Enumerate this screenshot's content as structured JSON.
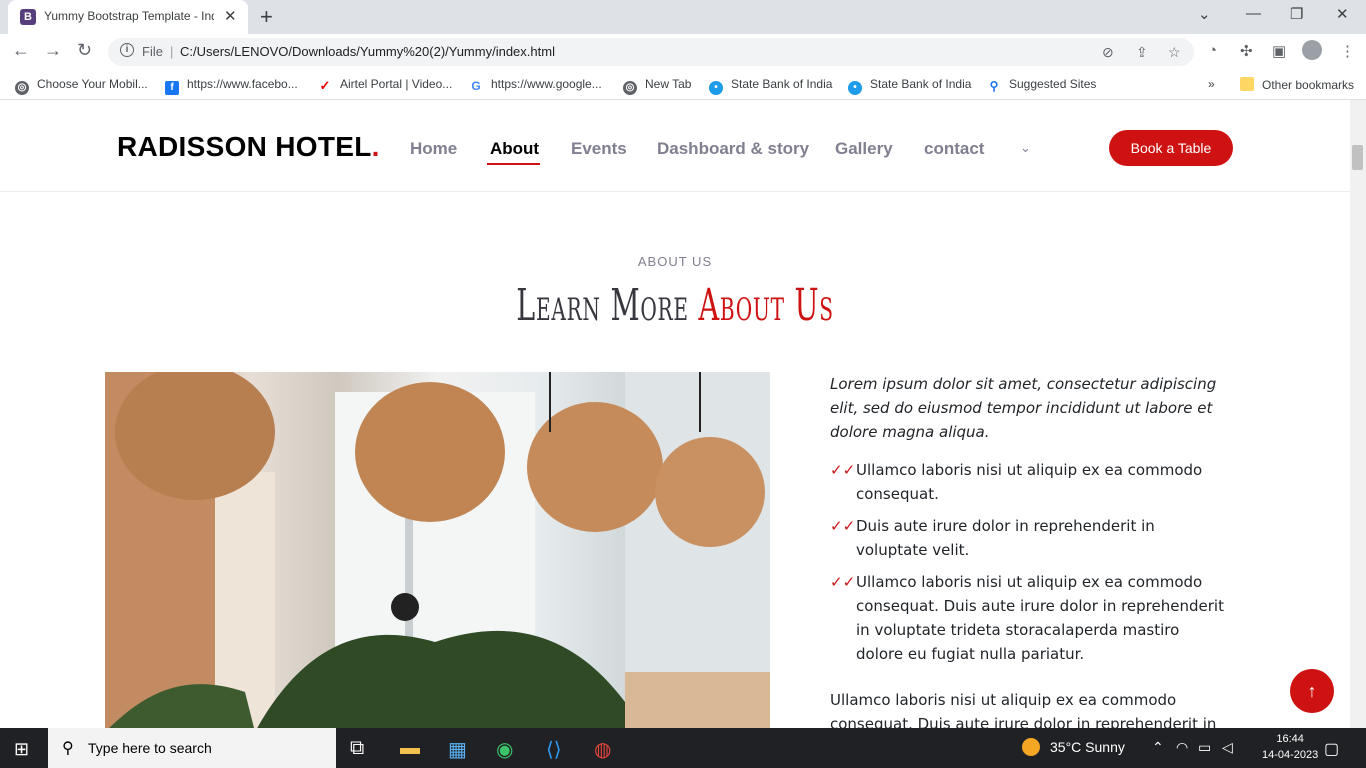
{
  "browser": {
    "tab_title": "Yummy Bootstrap Template - Index",
    "favicon_letter": "B",
    "url_scheme": "File",
    "url": "C:/Users/LENOVO/Downloads/Yummy%20(2)/Yummy/index.html",
    "bookmarks": [
      {
        "label": "Choose Your Mobil...",
        "icon": "globe-icon"
      },
      {
        "label": "https://www.facebo...",
        "icon": "facebook-icon"
      },
      {
        "label": "Airtel Portal | Video...",
        "icon": "airtel-icon"
      },
      {
        "label": "https://www.google...",
        "icon": "google-icon"
      },
      {
        "label": "New Tab",
        "icon": "globe-icon"
      },
      {
        "label": "State Bank of India",
        "icon": "sbi-icon"
      },
      {
        "label": "State Bank of India",
        "icon": "sbi-icon"
      },
      {
        "label": "Suggested Sites",
        "icon": "search-icon"
      }
    ],
    "other_bookmarks": "Other bookmarks"
  },
  "site": {
    "logo": "RADISSON HOTEL",
    "logo_dot": ".",
    "nav": [
      "Home",
      "About",
      "Events",
      "Dashboard & story",
      "Gallery",
      "contact"
    ],
    "active_nav": "About",
    "book_button": "Book a Table",
    "accent_color": "#ce1212"
  },
  "about": {
    "eyebrow": "About Us",
    "title_main": "Learn More",
    "title_accent": "About Us",
    "intro": "Lorem ipsum dolor sit amet, consectetur adipiscing elit, sed do eiusmod tempor incididunt ut labore et dolore magna aliqua.",
    "items": [
      "Ullamco laboris nisi ut aliquip ex ea commodo consequat.",
      "Duis aute irure dolor in reprehenderit in voluptate velit.",
      "Ullamco laboris nisi ut aliquip ex ea commodo consequat. Duis aute irure dolor in reprehenderit in voluptate trideta storacalaperda mastiro dolore eu fugiat nulla pariatur."
    ],
    "tail": "Ullamco laboris nisi ut aliquip ex ea commodo consequat. Duis aute irure dolor in reprehenderit in"
  },
  "taskbar": {
    "search_placeholder": "Type here to search",
    "weather": "35°C  Sunny",
    "time": "16:44",
    "date": "14-04-2023"
  }
}
